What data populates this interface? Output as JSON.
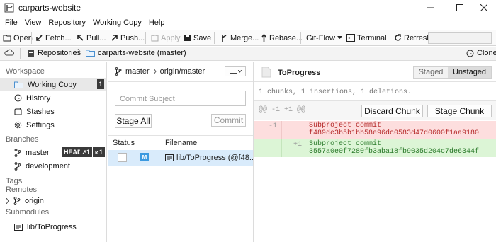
{
  "window": {
    "title": "carparts-website"
  },
  "menu": [
    "File",
    "View",
    "Repository",
    "Working Copy",
    "Help"
  ],
  "toolbar": {
    "open": "Open",
    "fetch": "Fetch...",
    "pull": "Pull...",
    "push": "Push...",
    "apply": "Apply",
    "save": "Save",
    "merge": "Merge...",
    "rebase": "Rebase...",
    "gitflow": "Git-Flow",
    "terminal": "Terminal",
    "refresh": "Refresh"
  },
  "breadcrumb": {
    "repositories": "Repositories",
    "current": "carparts-website (master)",
    "clone": "Clone"
  },
  "sidebar": {
    "workspace_header": "Workspace",
    "workspace_items": [
      {
        "label": "Working Copy",
        "badge": "1"
      },
      {
        "label": "History"
      },
      {
        "label": "Stashes"
      },
      {
        "label": "Settings"
      }
    ],
    "branches_header": "Branches",
    "branches": [
      {
        "label": "master",
        "head": "HEAD",
        "ahead": "1",
        "behind": "1"
      },
      {
        "label": "development"
      }
    ],
    "tags_header": "Tags",
    "remotes_header": "Remotes",
    "remotes": [
      {
        "label": "origin"
      }
    ],
    "submodules_header": "Submodules",
    "submodules": [
      {
        "label": "lib/ToProgress"
      }
    ]
  },
  "middle": {
    "branch": "master",
    "remote_branch": "origin/master",
    "commit_subject_placeholder": "Commit Subject",
    "stage_all": "Stage All",
    "commit": "Commit",
    "col_status": "Status",
    "col_filename": "Filename",
    "files": [
      {
        "status_badge": "M",
        "name": "lib/ToProgress (@f48..."
      }
    ]
  },
  "right": {
    "file_title": "ToProgress",
    "tab_staged": "Staged",
    "tab_unstaged": "Unstaged",
    "summary": "1 chunks, 1 insertions, 1 deletions.",
    "hunk_header": "@@ -1 +1 @@",
    "discard_chunk": "Discard Chunk",
    "stage_chunk": "Stage Chunk",
    "diff_lines": [
      {
        "old": "-1",
        "new": "",
        "text1": "Subproject commit",
        "text2": "f489de3b5b1bb58e96dc0583d47d0600f1aa9180",
        "kind": "del"
      },
      {
        "old": "",
        "new": "+1",
        "text1": "Subproject commit",
        "text2": "3557a0e0f7280fb3aba18fb9035d204c7de6344f",
        "kind": "add"
      }
    ]
  },
  "colors": {
    "del_bg": "#fddede",
    "add_bg": "#dcf5d6",
    "del_text": "#b52a2a",
    "add_text": "#2a7a2a",
    "modified_badge": "#3c9ae0",
    "selected_row": "#d9ebfb"
  }
}
